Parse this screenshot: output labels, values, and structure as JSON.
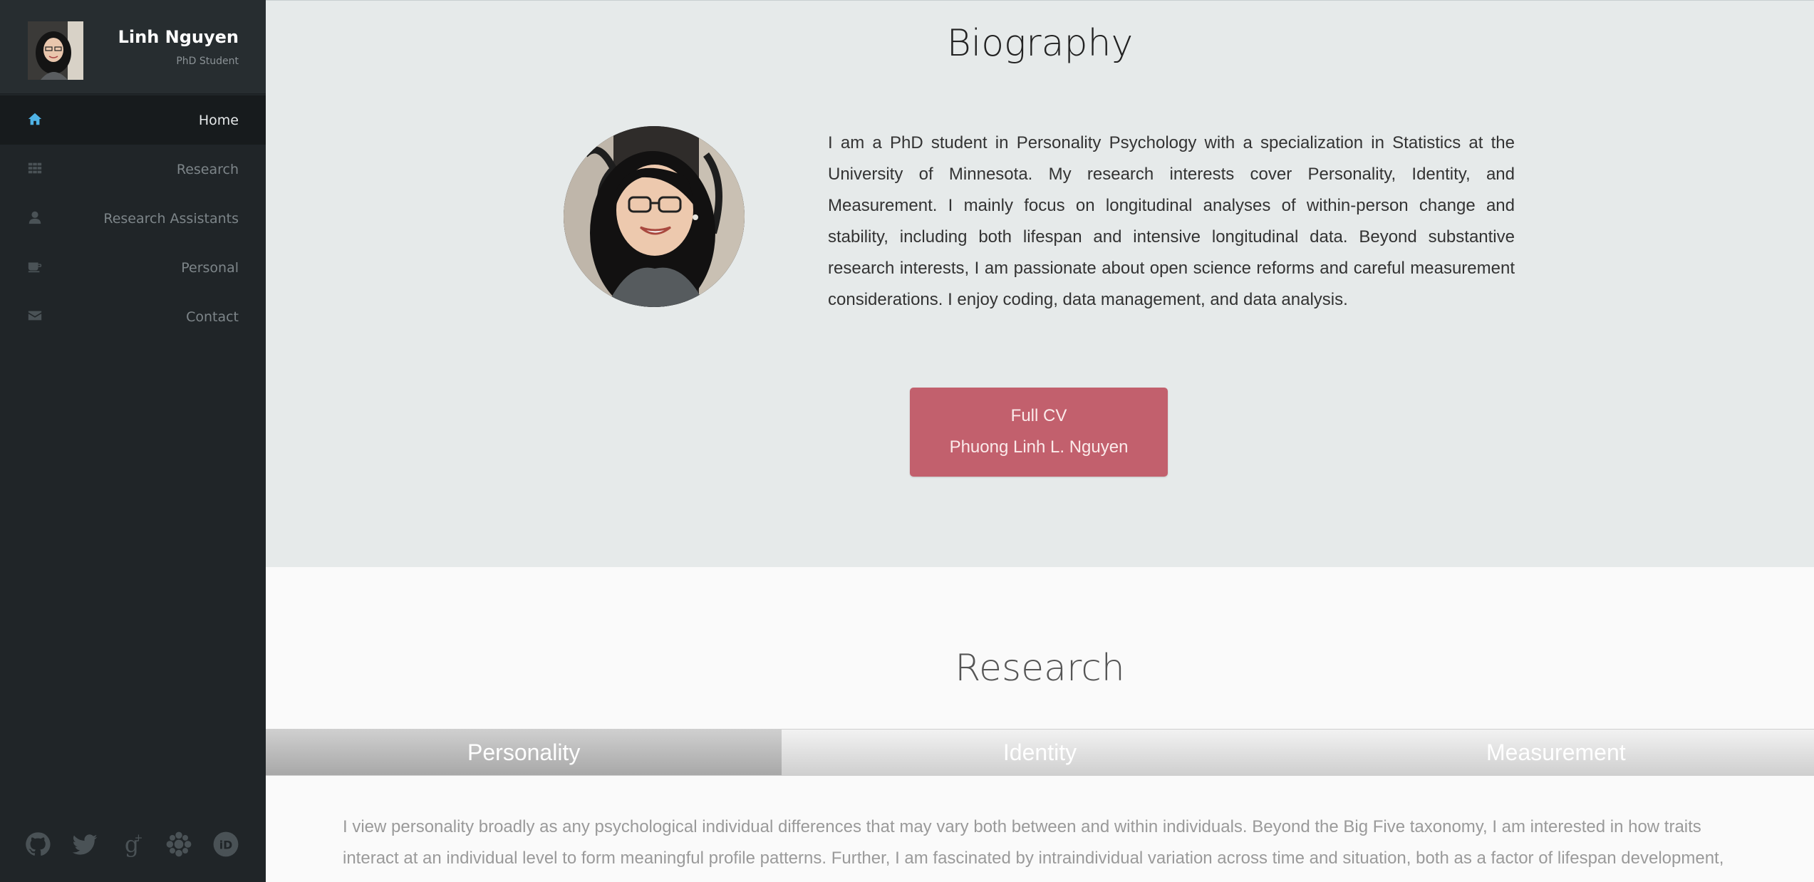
{
  "sidebar": {
    "name": "Linh Nguyen",
    "role": "PhD Student",
    "nav": [
      {
        "label": "Home",
        "icon": "home-icon"
      },
      {
        "label": "Research",
        "icon": "grid-icon"
      },
      {
        "label": "Research Assistants",
        "icon": "user-icon"
      },
      {
        "label": "Personal",
        "icon": "coffee-icon"
      },
      {
        "label": "Contact",
        "icon": "envelope-icon"
      }
    ],
    "socials": [
      "github-icon",
      "twitter-icon",
      "google-scholar-icon",
      "osf-icon",
      "orcid-icon"
    ],
    "accent_color": "#4fb3e6"
  },
  "bio": {
    "title": "Biography",
    "text": "I am a PhD student in Personality Psychology with a specialization in Statistics at the University of Minnesota. My research interests cover Personality, Identity, and Measurement. I mainly focus on longitudinal analyses of within-person change and stability, including both lifespan and intensive longitudinal data. Beyond substantive research interests, I am passionate about open science reforms and careful measurement considerations. I enjoy coding, data management, and data analysis.",
    "cv_line1": "Full CV",
    "cv_line2": "Phuong Linh L. Nguyen",
    "button_color": "#c2606d"
  },
  "research": {
    "title": "Research",
    "tabs": [
      "Personality",
      "Identity",
      "Measurement"
    ],
    "active_tab": "Personality",
    "text": "I view personality broadly as any psychological individual differences that may vary both between and within individuals. Beyond the Big Five taxonomy, I am interested in how traits interact at an individual level to form meaningful profile patterns. Further, I am fascinated by intraindividual variation across time and situation, both as a factor of lifespan development, meaningful"
  }
}
